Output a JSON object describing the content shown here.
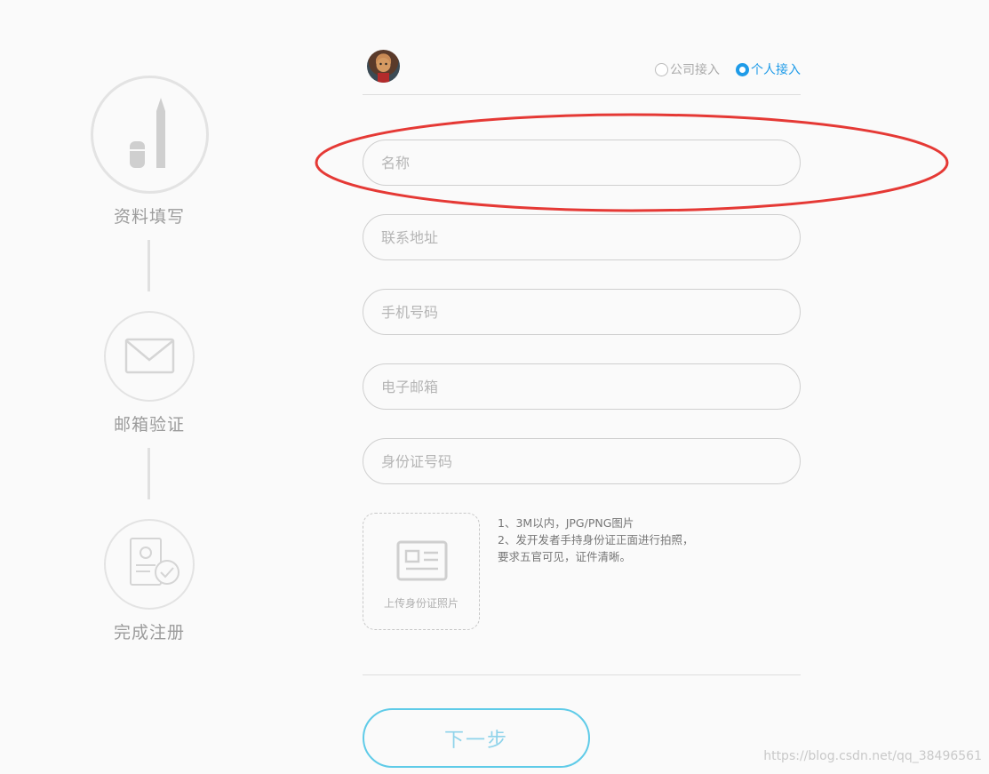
{
  "steps": [
    {
      "label": "资料填写",
      "icon": "pen-icon"
    },
    {
      "label": "邮箱验证",
      "icon": "mail-icon"
    },
    {
      "label": "完成注册",
      "icon": "registration-done-icon"
    }
  ],
  "access_type": {
    "options": [
      {
        "label": "公司接入",
        "checked": false
      },
      {
        "label": "个人接入",
        "checked": true
      }
    ]
  },
  "form": {
    "name": {
      "placeholder": "名称",
      "value": ""
    },
    "address": {
      "placeholder": "联系地址",
      "value": ""
    },
    "phone": {
      "placeholder": "手机号码",
      "value": ""
    },
    "email": {
      "placeholder": "电子邮箱",
      "value": ""
    },
    "id_number": {
      "placeholder": "身份证号码",
      "value": ""
    }
  },
  "upload": {
    "label": "上传身份证照片",
    "tips": [
      "1、3M以内，JPG/PNG图片",
      "2、发开发者手持身份证正面进行拍照，",
      "要求五官可见，证件清晰。"
    ]
  },
  "next_button": "下一步",
  "watermark": "https://blog.csdn.net/qq_38496561",
  "colors": {
    "accent": "#1e9be8",
    "button_border": "#5fcbe8",
    "highlight": "#e53935"
  }
}
